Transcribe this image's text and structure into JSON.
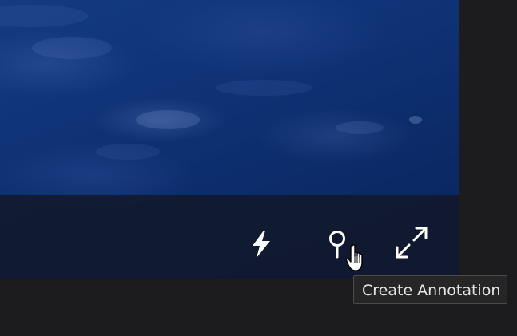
{
  "player": {
    "controls": {
      "flash_icon": "lightning-bolt",
      "annotation_icon": "map-pin",
      "fullscreen_icon": "expand-arrows"
    },
    "tooltip": {
      "text": "Create Annotation"
    },
    "cursor": "pointing-hand"
  },
  "colors": {
    "video_primary": "#0f3275",
    "control_bar": "#12162380",
    "page_background": "#1c1c1e",
    "tooltip_background": "#262626",
    "tooltip_text": "#e6e6e6",
    "icon": "#ffffff"
  }
}
